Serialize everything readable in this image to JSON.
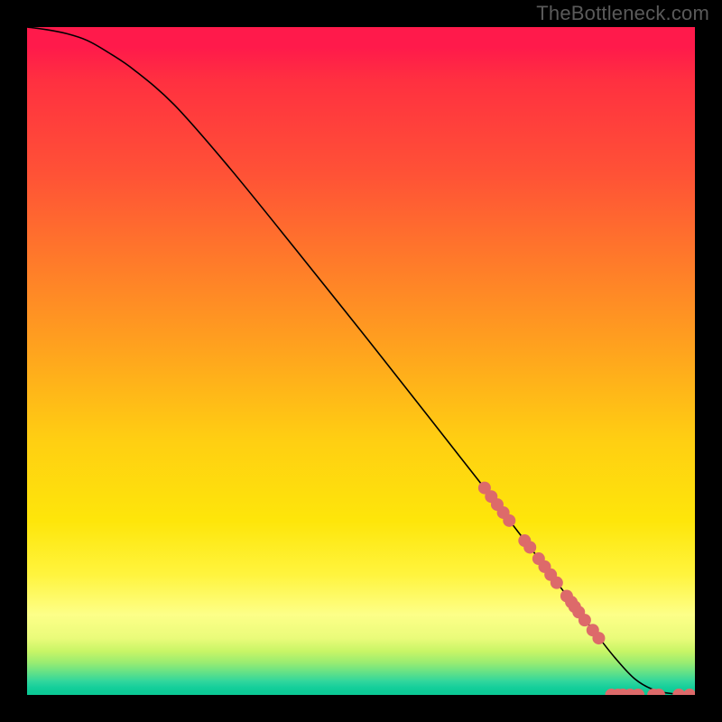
{
  "watermark": "TheBottleneck.com",
  "chart_data": {
    "type": "line",
    "title": "",
    "xlabel": "",
    "ylabel": "",
    "xlim": [
      0,
      100
    ],
    "ylim": [
      0,
      100
    ],
    "grid": false,
    "curve": {
      "x": [
        0,
        3,
        6,
        9,
        12,
        16,
        22,
        30,
        40,
        50,
        60,
        68,
        74,
        78,
        82,
        85,
        88,
        91,
        94,
        97,
        100
      ],
      "y": [
        100,
        99.6,
        99.0,
        98.0,
        96.3,
        93.6,
        88.4,
        79.3,
        67.0,
        54.5,
        41.8,
        31.6,
        23.8,
        18.6,
        13.3,
        9.4,
        5.6,
        2.4,
        0.7,
        0.15,
        0
      ]
    },
    "line_color": "#000000",
    "scatter": {
      "color": "#dd6a6a",
      "radius_px": 7,
      "points": [
        {
          "x": 68.5,
          "y": 31.0
        },
        {
          "x": 69.5,
          "y": 29.7
        },
        {
          "x": 70.4,
          "y": 28.5
        },
        {
          "x": 71.3,
          "y": 27.3
        },
        {
          "x": 72.2,
          "y": 26.1
        },
        {
          "x": 74.5,
          "y": 23.1
        },
        {
          "x": 75.3,
          "y": 22.1
        },
        {
          "x": 76.6,
          "y": 20.4
        },
        {
          "x": 77.5,
          "y": 19.2
        },
        {
          "x": 78.4,
          "y": 18.0
        },
        {
          "x": 79.3,
          "y": 16.8
        },
        {
          "x": 80.8,
          "y": 14.8
        },
        {
          "x": 81.5,
          "y": 13.9
        },
        {
          "x": 82.0,
          "y": 13.2
        },
        {
          "x": 82.6,
          "y": 12.4
        },
        {
          "x": 83.5,
          "y": 11.2
        },
        {
          "x": 84.7,
          "y": 9.7
        },
        {
          "x": 85.6,
          "y": 8.5
        },
        {
          "x": 87.5,
          "y": 0.0
        },
        {
          "x": 88.5,
          "y": 0.0
        },
        {
          "x": 89.2,
          "y": 0.0
        },
        {
          "x": 90.3,
          "y": 0.0
        },
        {
          "x": 91.5,
          "y": 0.0
        },
        {
          "x": 93.8,
          "y": 0.0
        },
        {
          "x": 94.6,
          "y": 0.0
        },
        {
          "x": 97.6,
          "y": 0.0
        },
        {
          "x": 99.2,
          "y": 0.0
        }
      ]
    }
  }
}
